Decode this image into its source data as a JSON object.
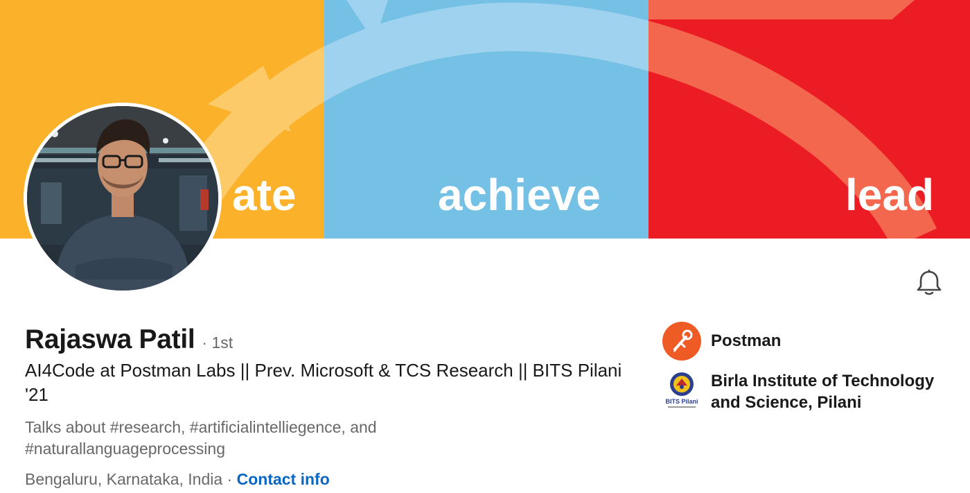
{
  "banner": {
    "words": [
      "ate",
      "achieve",
      "lead"
    ],
    "colors": {
      "left": "#fbb12a",
      "middle": "#75c1e6",
      "right": "#ec1c24"
    }
  },
  "profile": {
    "name": "Rajaswa Patil",
    "degree": "· 1st",
    "headline": "AI4Code at Postman Labs || Prev. Microsoft & TCS Research || BITS Pilani '21",
    "talks_about": "Talks about #research, #artificialintelliegence, and #naturallanguageprocessing",
    "location": "Bengaluru, Karnataka, India",
    "separator": "·",
    "contact_label": "Contact info",
    "notification_icon": "bell-icon"
  },
  "organizations": [
    {
      "name": "Postman",
      "logo": "postman-logo",
      "color": "#ef5b25"
    },
    {
      "name": "Birla Institute of Technology and Science, Pilani",
      "logo": "bits-pilani-logo",
      "logo_text": "BITS Pilani"
    }
  ],
  "colors": {
    "link": "#0a66c2",
    "text_primary": "#191919",
    "text_secondary": "#666666"
  }
}
